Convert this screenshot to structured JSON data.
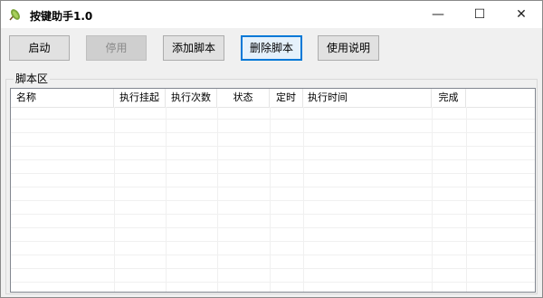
{
  "window": {
    "title": "按键助手1.0",
    "minimize_glyph": "—",
    "maximize_glyph": "☐",
    "close_glyph": "✕",
    "icon": "app-icon"
  },
  "toolbar": {
    "start_label": "启动",
    "stop_label": "停用",
    "add_label": "添加脚本",
    "delete_label": "删除脚本",
    "help_label": "使用说明"
  },
  "script_area": {
    "group_label": "脚本区",
    "columns": [
      "名称",
      "执行挂起",
      "执行次数",
      "状态",
      "定时",
      "执行时间",
      "完成"
    ]
  }
}
